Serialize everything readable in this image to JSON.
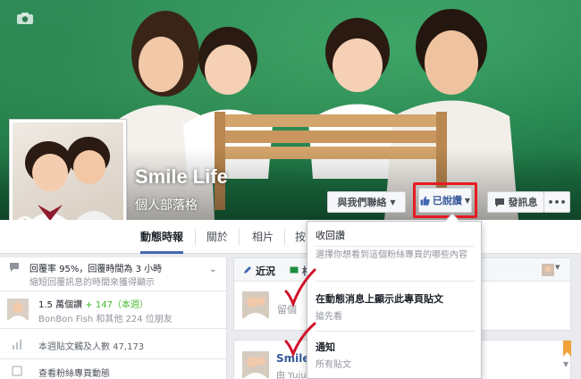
{
  "page": {
    "title": "Smile Life",
    "category": "個人部落格"
  },
  "actions": {
    "contact_label": "與我們聯絡",
    "liked_label": "已說讚",
    "message_label": "發訊息",
    "more_label": "•••"
  },
  "tabs": [
    {
      "label": "動態時報"
    },
    {
      "label": "關於"
    },
    {
      "label": "相片"
    },
    {
      "label": "按"
    }
  ],
  "left": {
    "response_rate": "回覆率 95%，回覆時間為 3 小時",
    "response_note": "縮短回覆訊息的時間來獲得顯示",
    "likes_count": "1.5 萬個讚",
    "likes_new": "+ 147（本週）",
    "likes_friends": "BonBon Fish 和其他 224 位朋友",
    "reach": "本週貼文觸及人數 47,173",
    "view_activity": "查看粉絲專頁動態"
  },
  "feed": {
    "tab_recent": "近況",
    "tab_second": "相",
    "comment_placeholder": "留個",
    "post_author": "Smile",
    "post_meta": "由 Yuju"
  },
  "dropdown": {
    "header": "收回讚",
    "description": "選擇你想看到這個粉絲專頁的哪些內容",
    "option1_title": "在動態消息上顯示此專頁貼文",
    "option1_sub": "搶先看",
    "option2_title": "通知",
    "option2_sub": "所有貼文"
  },
  "colors": {
    "facebook_blue": "#4267b2",
    "highlight_red": "#e51c23",
    "checkmark_red": "#d0122a",
    "cover_green": "#2e8b57"
  }
}
